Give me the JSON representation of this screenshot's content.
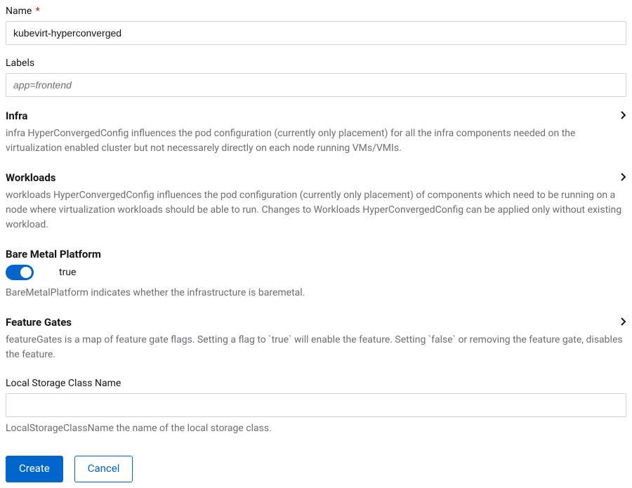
{
  "fields": {
    "name": {
      "label": "Name",
      "required": true,
      "value": "kubevirt-hyperconverged"
    },
    "labels": {
      "label": "Labels",
      "placeholder": "app=frontend"
    },
    "localStorageClassName": {
      "label": "Local Storage Class Name",
      "value": "",
      "description": "LocalStorageClassName the name of the local storage class."
    }
  },
  "sections": {
    "infra": {
      "title": "Infra",
      "description": "infra HyperConvergedConfig influences the pod configuration (currently only placement) for all the infra components needed on the virtualization enabled cluster but not necessarely directly on each node running VMs/VMIs."
    },
    "workloads": {
      "title": "Workloads",
      "description": "workloads HyperConvergedConfig influences the pod configuration (currently only placement) of components which need to be running on a node where virtualization workloads should be able to run. Changes to Workloads HyperConvergedConfig can be applied only without existing workload."
    },
    "bareMetal": {
      "title": "Bare Metal Platform",
      "value": "true",
      "description": "BareMetalPlatform indicates whether the infrastructure is baremetal."
    },
    "featureGates": {
      "title": "Feature Gates",
      "description": "featureGates is a map of feature gate flags. Setting a flag to `true` will enable the feature. Setting `false` or removing the feature gate, disables the feature."
    }
  },
  "buttons": {
    "create": "Create",
    "cancel": "Cancel"
  }
}
